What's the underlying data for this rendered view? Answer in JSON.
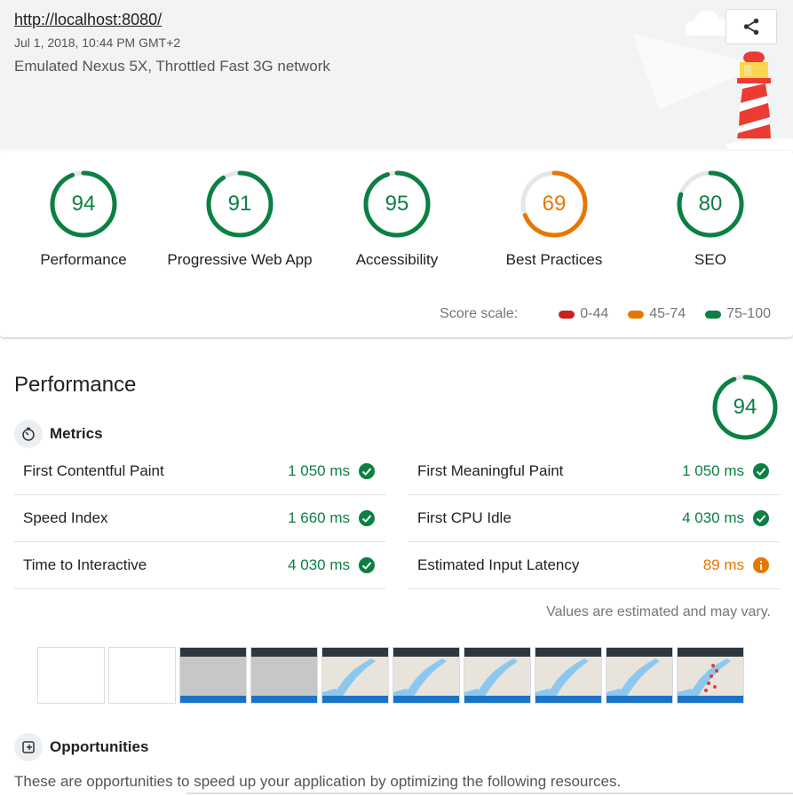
{
  "header": {
    "url": "http://localhost:8080/",
    "date": "Jul 1, 2018, 10:44 PM GMT+2",
    "environment": "Emulated Nexus 5X, Throttled Fast 3G network",
    "share_icon": "share-icon"
  },
  "colors": {
    "pass": "#0b8043",
    "average": "#e67700",
    "fail": "#c7221f",
    "track": "#e6e6e6",
    "header_bg": "#f1f3f4"
  },
  "categories": [
    {
      "label": "Performance",
      "score": 94,
      "status": "pass"
    },
    {
      "label": "Progressive Web App",
      "score": 91,
      "status": "pass"
    },
    {
      "label": "Accessibility",
      "score": 95,
      "status": "pass"
    },
    {
      "label": "Best Practices",
      "score": 69,
      "status": "average"
    },
    {
      "label": "SEO",
      "score": 80,
      "status": "pass"
    }
  ],
  "score_scale": {
    "label": "Score scale:",
    "ranges": [
      {
        "label": "0-44",
        "status": "fail"
      },
      {
        "label": "45-74",
        "status": "average"
      },
      {
        "label": "75-100",
        "status": "pass"
      }
    ]
  },
  "performance": {
    "title": "Performance",
    "score": 94,
    "metrics_heading": "Metrics",
    "metrics": [
      {
        "name": "First Contentful Paint",
        "value": "1 050 ms",
        "status": "pass"
      },
      {
        "name": "First Meaningful Paint",
        "value": "1 050 ms",
        "status": "pass"
      },
      {
        "name": "Speed Index",
        "value": "1 660 ms",
        "status": "pass"
      },
      {
        "name": "First CPU Idle",
        "value": "4 030 ms",
        "status": "pass"
      },
      {
        "name": "Time to Interactive",
        "value": "4 030 ms",
        "status": "pass"
      },
      {
        "name": "Estimated Input Latency",
        "value": "89 ms",
        "status": "average"
      }
    ],
    "note": "Values are estimated and may vary.",
    "filmstrip": [
      "blank",
      "blank",
      "gray",
      "gray",
      "map",
      "map",
      "map",
      "map",
      "map",
      "map-markers"
    ],
    "opportunities_heading": "Opportunities",
    "opportunities_description": "These are opportunities to speed up your application by optimizing the following resources."
  }
}
